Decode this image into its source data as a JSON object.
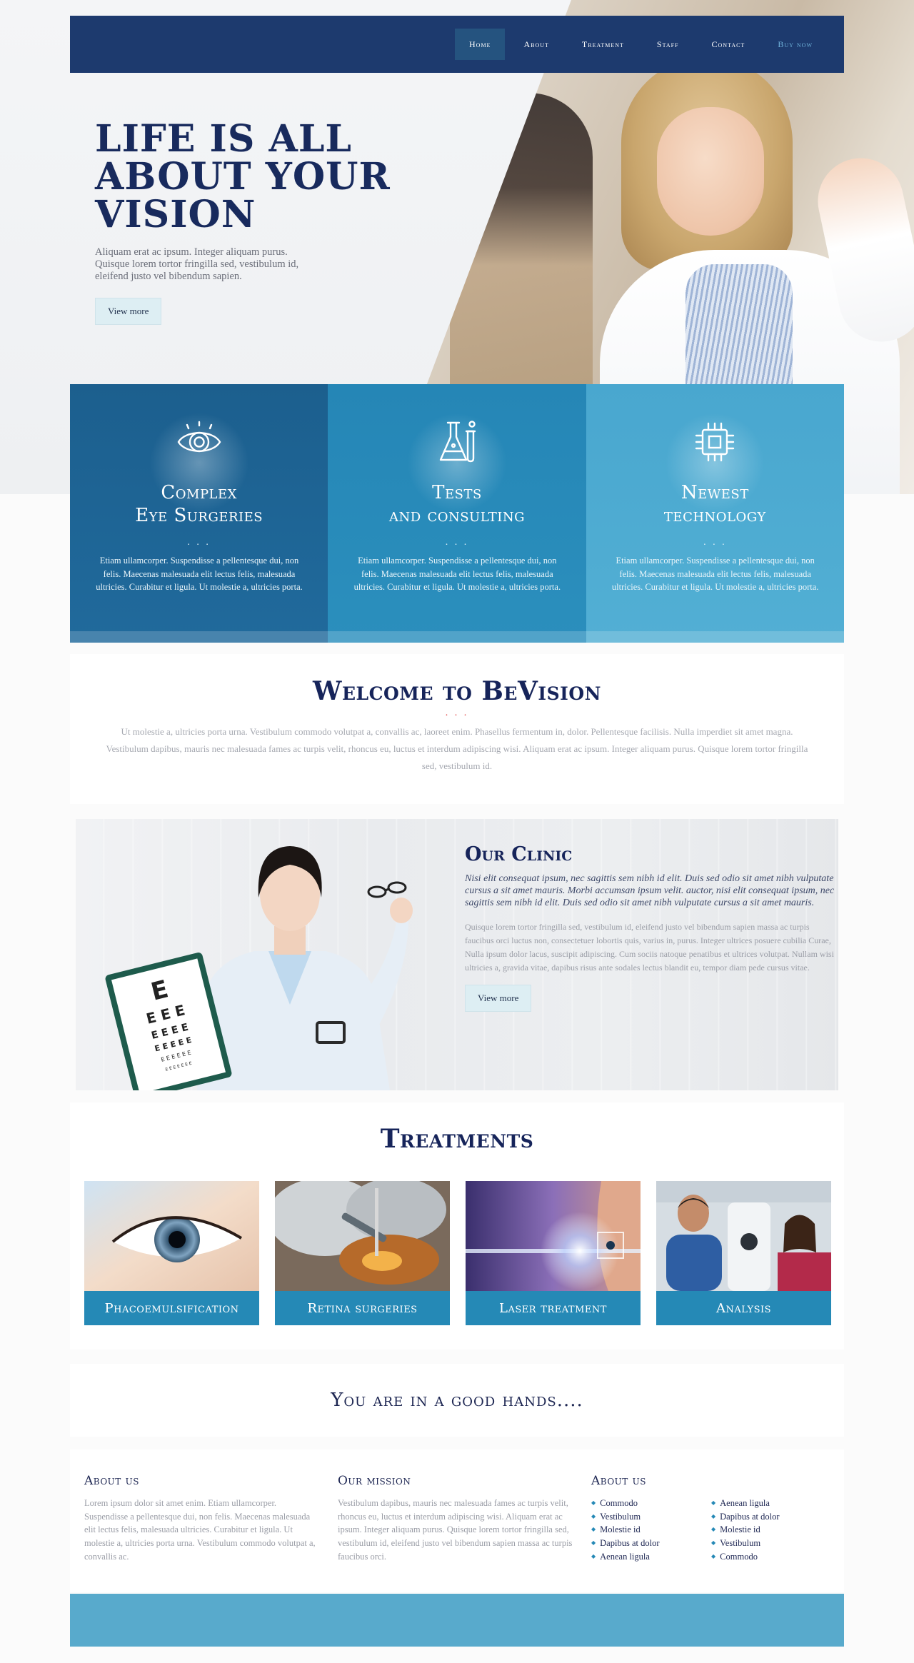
{
  "nav": {
    "items": [
      {
        "label": "Home"
      },
      {
        "label": "About"
      },
      {
        "label": "Treatment"
      },
      {
        "label": "Staff"
      },
      {
        "label": "Contact"
      },
      {
        "label": "Buy now"
      }
    ]
  },
  "hero": {
    "title": "LIFE IS ALL ABOUT YOUR VISION",
    "description": "Aliquam erat ac ipsum. Integer aliquam purus. Quisque lorem tortor fringilla sed, vestibulum id, eleifend justo vel bibendum sapien.",
    "button": "View more"
  },
  "features": [
    {
      "icon": "eye-icon",
      "title_line1": "Complex",
      "title_line2": "Eye Surgeries",
      "dots": ". . .",
      "description": "Etiam ullamcorper. Suspendisse a pellentesque dui, non felis. Maecenas malesuada elit lectus felis, malesuada ultricies. Curabitur et ligula. Ut molestie a, ultricies porta."
    },
    {
      "icon": "flask-icon",
      "title_line1": "Tests",
      "title_line2": "and consulting",
      "dots": ". . .",
      "description": "Etiam ullamcorper. Suspendisse a pellentesque dui, non felis. Maecenas malesuada elit lectus felis, malesuada ultricies. Curabitur et ligula. Ut molestie a, ultricies porta."
    },
    {
      "icon": "chip-icon",
      "title_line1": "Newest",
      "title_line2": "technology",
      "dots": ". . .",
      "description": "Etiam ullamcorper. Suspendisse a pellentesque dui, non felis. Maecenas malesuada elit lectus felis, malesuada ultricies. Curabitur et ligula. Ut molestie a, ultricies porta."
    }
  ],
  "welcome": {
    "title": "Welcome to BeVision",
    "dots": ". . .",
    "text": "Ut molestie a, ultricies porta urna. Vestibulum commodo volutpat a, convallis ac, laoreet enim. Phasellus fermentum in, dolor. Pellentesque facilisis. Nulla imperdiet sit amet magna. Vestibulum dapibus, mauris nec malesuada fames ac turpis velit, rhoncus eu, luctus et interdum adipiscing wisi. Aliquam erat ac ipsum. Integer aliquam purus. Quisque lorem tortor fringilla sed, vestibulum id."
  },
  "clinic": {
    "title": "Our Clinic",
    "lead": "Nisi elit consequat ipsum, nec sagittis sem nibh id elit. Duis sed odio sit amet nibh vulputate cursus a sit amet mauris. Morbi accumsan ipsum velit. auctor, nisi elit consequat ipsum, nec sagittis sem nibh id elit. Duis sed odio sit amet nibh vulputate cursus a sit amet mauris.",
    "body": "Quisque lorem tortor fringilla sed, vestibulum id, eleifend justo vel bibendum sapien massa ac turpis faucibus orci luctus non, consectetuer lobortis quis, varius in, purus. Integer ultrices posuere cubilia Curae, Nulla ipsum dolor lacus, suscipit adipiscing. Cum sociis natoque penatibus et ultrices volutpat. Nullam wisi ultricies a, gravida vitae, dapibus risus ante sodales lectus blandit eu, tempor diam pede cursus vitae.",
    "button": "View more"
  },
  "treatments": {
    "title": "Treatments",
    "items": [
      {
        "label": "Phacoemulsification"
      },
      {
        "label": "Retina surgeries"
      },
      {
        "label": "Laser treatment"
      },
      {
        "label": "Analysis"
      }
    ]
  },
  "goodhands": {
    "text": "You are in a good hands...."
  },
  "footer": {
    "about": {
      "title": "About us",
      "text": "Lorem ipsum dolor sit amet enim. Etiam ullamcorper. Suspendisse a pellentesque dui, non felis. Maecenas malesuada elit lectus felis, malesuada ultricies. Curabitur et ligula. Ut molestie a, ultricies porta urna. Vestibulum commodo volutpat a, convallis ac."
    },
    "mission": {
      "title": "Our mission",
      "text": "Vestibulum dapibus, mauris nec malesuada fames ac turpis velit, rhoncus eu, luctus et interdum adipiscing wisi. Aliquam erat ac ipsum. Integer aliquam purus. Quisque lorem tortor fringilla sed, vestibulum id, eleifend justo vel bibendum sapien massa ac turpis faucibus orci."
    },
    "links": {
      "title": "About us",
      "col1": [
        "Commodo",
        "Vestibulum",
        "Molestie id",
        "Dapibus at dolor",
        "Aenean ligula"
      ],
      "col2": [
        "Aenean ligula",
        "Dapibus at dolor",
        "Molestie id",
        "Vestibulum",
        "Commodo"
      ]
    }
  },
  "colors": {
    "navy": "#1d3a6e",
    "title_navy": "#16245a",
    "accent_blue": "#2589b6",
    "footer_bar": "#58aacc",
    "dots_red": "#e03b3b"
  }
}
